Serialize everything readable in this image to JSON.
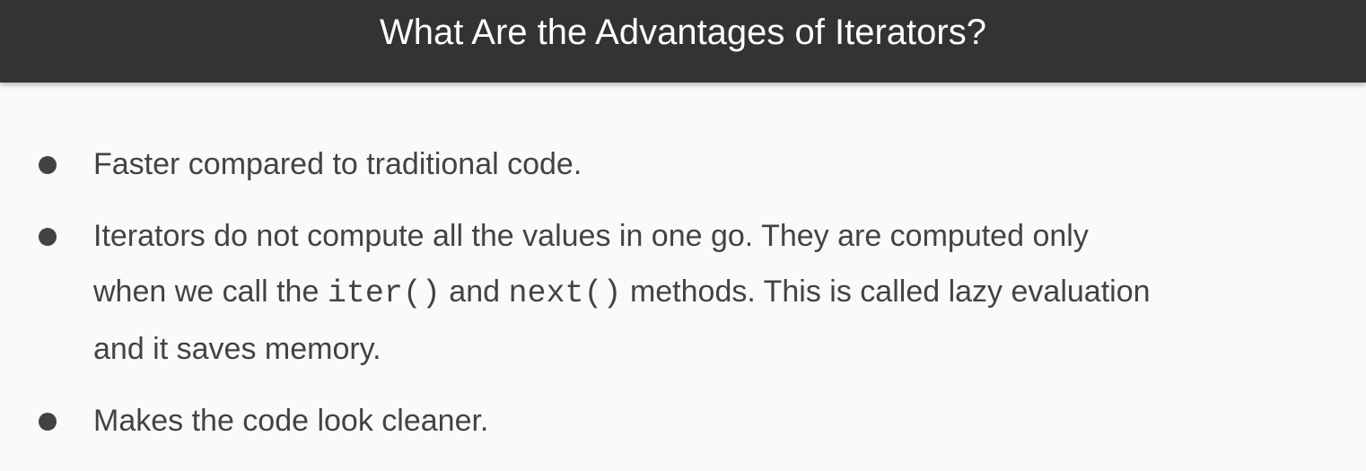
{
  "slide": {
    "title": "What Are the Advantages of Iterators?",
    "bullets": [
      {
        "text": "Faster compared to traditional code."
      },
      {
        "line1": "Iterators do not compute all the values in one go. They are computed only",
        "line2_a": "when we call the ",
        "code1": "iter()",
        "line2_b": " and ",
        "code2": "next()",
        "line2_c": " methods. This is called lazy evaluation",
        "line3": "and it saves memory."
      },
      {
        "text": "Makes the code look cleaner."
      }
    ]
  }
}
